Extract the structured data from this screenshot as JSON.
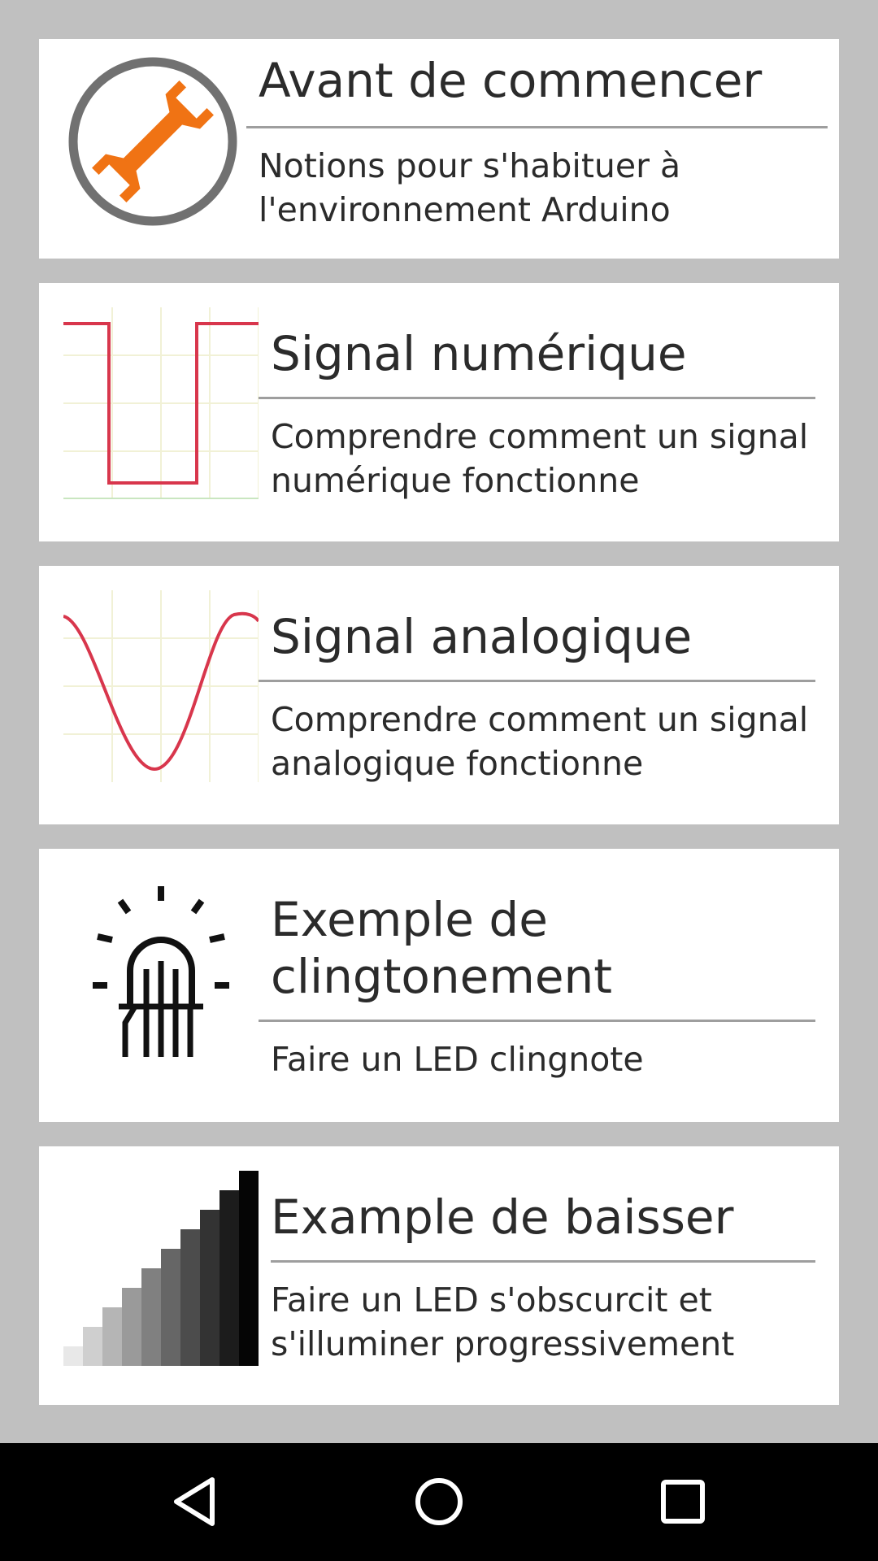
{
  "lessons": [
    {
      "title": "Avant de commencer",
      "description": "Notions pour s'habituer à\nl'environnement Arduino",
      "icon": "wrench-icon",
      "accent": "#f07314"
    },
    {
      "title": "Signal numérique",
      "description": "Comprendre comment un signal\nnumérique fonctionne",
      "icon": "square-wave-icon",
      "accent": "#d8364c"
    },
    {
      "title": "Signal analogique",
      "description": "Comprendre comment un signal\nanalogique fonctionne",
      "icon": "sine-wave-icon",
      "accent": "#d8364c"
    },
    {
      "title": "Exemple de\nclingtonement",
      "description": "Faire un LED clingnote",
      "icon": "blinking-led-icon",
      "accent": "#000000"
    },
    {
      "title": "Example de baisser",
      "description": "Faire un LED s'obscurcit et\ns'illuminer progressivement",
      "icon": "fade-gradient-icon",
      "accent": "#000000"
    }
  ],
  "navigation": {
    "back": "back-icon",
    "home": "home-icon",
    "recents": "recents-icon"
  }
}
